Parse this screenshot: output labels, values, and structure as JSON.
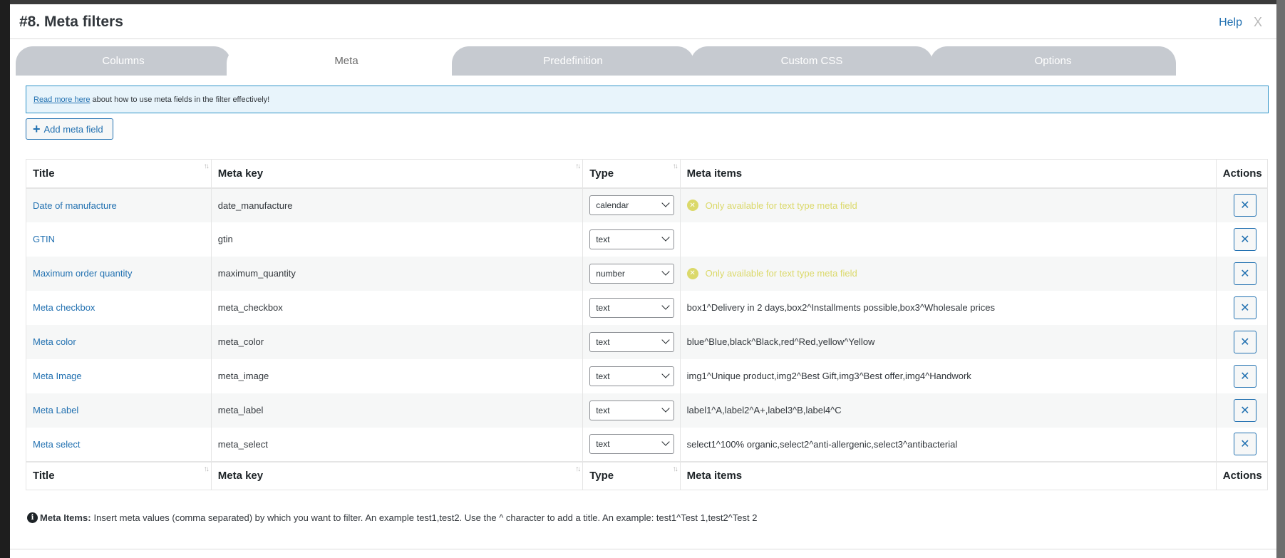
{
  "modal": {
    "title": "#8. Meta filters",
    "help": "Help",
    "close": "X"
  },
  "tabs": [
    {
      "label": "Columns",
      "active": false
    },
    {
      "label": "Meta",
      "active": true
    },
    {
      "label": "Predefinition",
      "active": false
    },
    {
      "label": "Custom CSS",
      "active": false
    },
    {
      "label": "Options",
      "active": false
    }
  ],
  "info": {
    "link": "Read more here",
    "text": " about how to use meta fields in the filter effectively!"
  },
  "add_button": {
    "label": "Add meta field"
  },
  "table": {
    "headers": [
      "Title",
      "Meta key",
      "Type",
      "Meta items",
      "Actions"
    ],
    "rows": [
      {
        "title": "Date of manufacture",
        "key": "date_manufacture",
        "type": "calendar",
        "items": "",
        "warning": "Only available for text type meta field"
      },
      {
        "title": "GTIN",
        "key": "gtin",
        "type": "text",
        "items": "",
        "warning": ""
      },
      {
        "title": "Maximum order quantity",
        "key": "maximum_quantity",
        "type": "number",
        "items": "",
        "warning": "Only available for text type meta field"
      },
      {
        "title": "Meta checkbox",
        "key": "meta_checkbox",
        "type": "text",
        "items": "box1^Delivery in 2 days,box2^Installments possible,box3^Wholesale prices",
        "warning": ""
      },
      {
        "title": "Meta color",
        "key": "meta_color",
        "type": "text",
        "items": "blue^Blue,black^Black,red^Red,yellow^Yellow",
        "warning": ""
      },
      {
        "title": "Meta Image",
        "key": "meta_image",
        "type": "text",
        "items": "img1^Unique product,img2^Best Gift,img3^Best offer,img4^Handwork",
        "warning": ""
      },
      {
        "title": "Meta Label",
        "key": "meta_label",
        "type": "text",
        "items": "label1^A,label2^A+,label3^B,label4^C",
        "warning": ""
      },
      {
        "title": "Meta select",
        "key": "meta_select",
        "type": "text",
        "items": "select1^100% organic,select2^anti-allergenic,select3^antibacterial",
        "warning": ""
      }
    ]
  },
  "footer": {
    "label": "Meta Items:",
    "text": "Insert meta values (comma separated) by which you want to filter. An example test1,test2. Use the ^ character to add a title. An example: test1^Test 1,test2^Test 2"
  },
  "icons": {
    "sort": "sort-arrows-icon",
    "delete": "close-x-icon",
    "warning": "circle-x-icon",
    "info": "info-icon",
    "plus": "plus-icon"
  },
  "colors": {
    "accent": "#2271b1",
    "warning": "#dbd96a",
    "tab_inactive": "#c6cad0",
    "info_bg": "#e8f4fb"
  }
}
